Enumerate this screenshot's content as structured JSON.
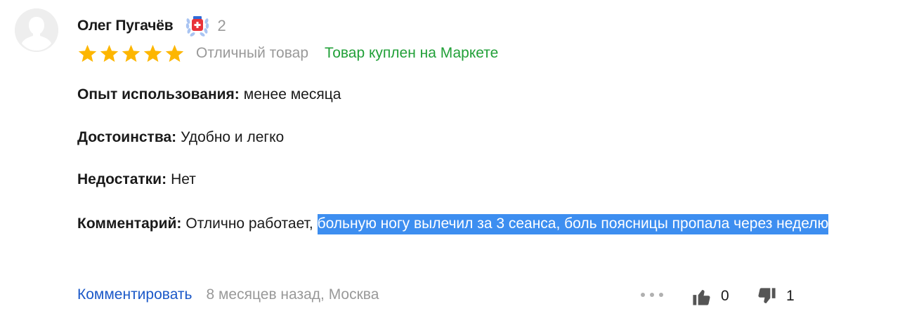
{
  "review": {
    "author": {
      "name": "Олег Пугачёв",
      "badge_icon": "laurel-badge-icon",
      "badge_count": "2"
    },
    "rating": {
      "stars_filled": 5,
      "stars_total": 5,
      "label": "Отличный товар",
      "verified_text": "Товар куплен на Маркете"
    },
    "fields": {
      "usage": {
        "label": "Опыт использования:",
        "value": "менее месяца"
      },
      "pros": {
        "label": "Достоинства:",
        "value": "Удобно и легко"
      },
      "cons": {
        "label": "Недостатки:",
        "value": "Нет"
      },
      "comment": {
        "label": "Комментарий:",
        "value_plain": "Отлично работает,",
        "value_selected": "больную ногу вылечил за 3 сеанса, боль поясницы пропала через неделю"
      }
    },
    "footer": {
      "reply_label": "Комментировать",
      "meta": "8 месяцев назад, Москва",
      "likes": "0",
      "dislikes": "1"
    }
  },
  "colors": {
    "star": "#fdb600",
    "verified": "#21a038",
    "link": "#1a58c8",
    "muted": "#999999",
    "selection": "#3d8ef0"
  }
}
